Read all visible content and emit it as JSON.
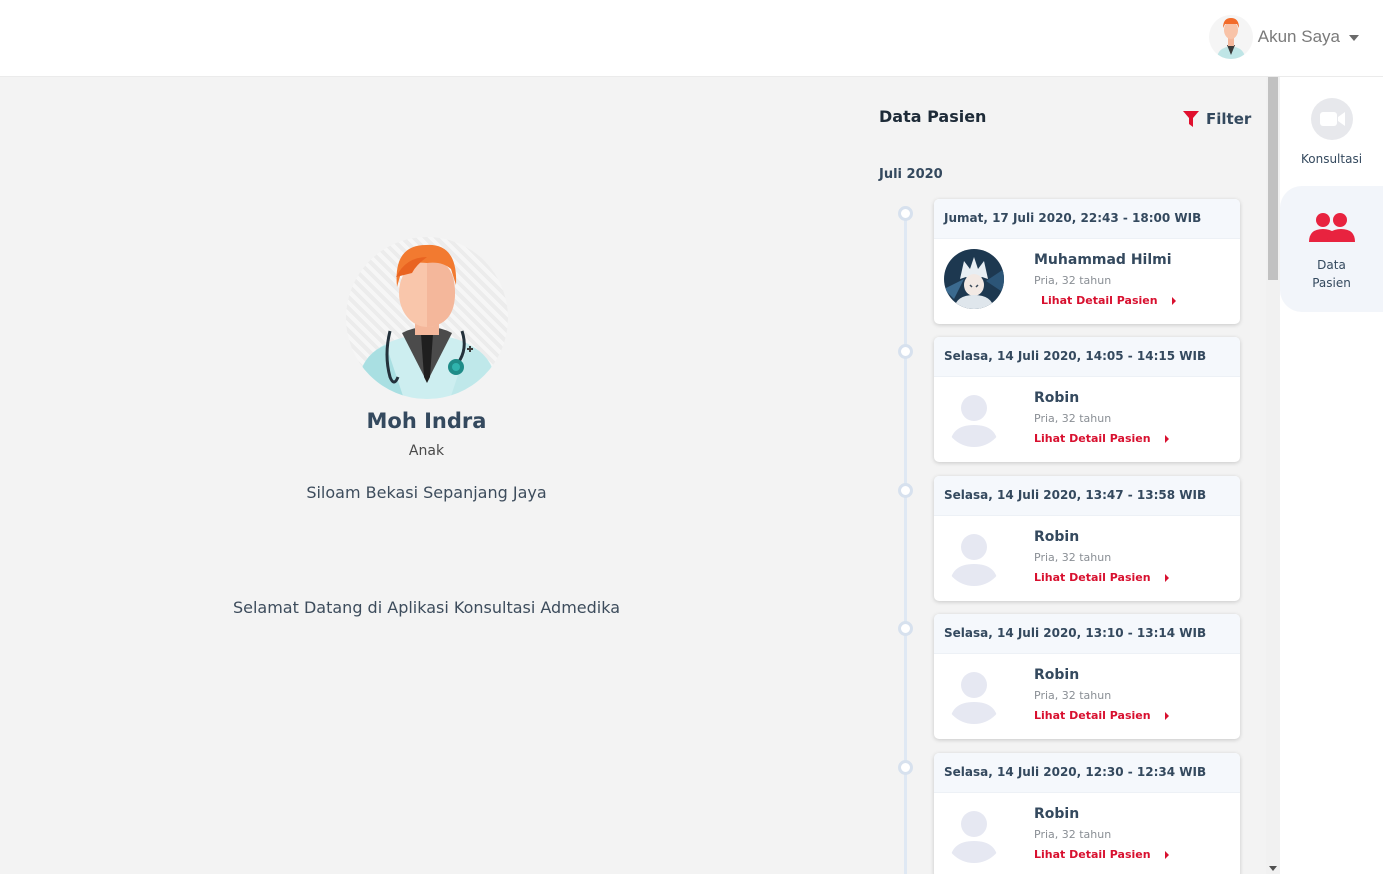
{
  "header": {
    "account_label": "Akun Saya"
  },
  "doctor": {
    "name": "Moh Indra",
    "specialty": "Anak",
    "hospital": "Siloam Bekasi Sepanjang Jaya",
    "welcome": "Selamat Datang di Aplikasi Konsultasi Admedika"
  },
  "patients_panel": {
    "title": "Data Pasien",
    "filter_label": "Filter",
    "month": "Juli 2020",
    "items": [
      {
        "datetime": "Jumat, 17 Juli 2020, 22:43 - 18:00 WIB",
        "name": "Muhammad Hilmi",
        "info": "Pria, 32 tahun",
        "link": "Lihat Detail Pasien",
        "photo": "anime-photo"
      },
      {
        "datetime": "Selasa, 14 Juli 2020, 14:05 - 14:15 WIB",
        "name": "Robin",
        "info": "Pria, 32 tahun",
        "link": "Lihat Detail Pasien",
        "photo": "placeholder"
      },
      {
        "datetime": "Selasa, 14 Juli 2020, 13:47 - 13:58 WIB",
        "name": "Robin",
        "info": "Pria, 32 tahun",
        "link": "Lihat Detail Pasien",
        "photo": "placeholder"
      },
      {
        "datetime": "Selasa, 14 Juli 2020, 13:10 - 13:14 WIB",
        "name": "Robin",
        "info": "Pria, 32 tahun",
        "link": "Lihat Detail Pasien",
        "photo": "placeholder"
      },
      {
        "datetime": "Selasa, 14 Juli 2020, 12:30 - 12:34 WIB",
        "name": "Robin",
        "info": "Pria, 32 tahun",
        "link": "Lihat Detail Pasien",
        "photo": "placeholder"
      }
    ]
  },
  "sidebar": {
    "items": [
      {
        "label": "Konsultasi",
        "icon": "video-camera-icon",
        "active": false
      },
      {
        "label": "Data Pasien",
        "icon": "users-icon",
        "active": true
      }
    ]
  },
  "colors": {
    "accent": "#d8102f",
    "text": "#34495e",
    "background": "#f3f3f3"
  }
}
